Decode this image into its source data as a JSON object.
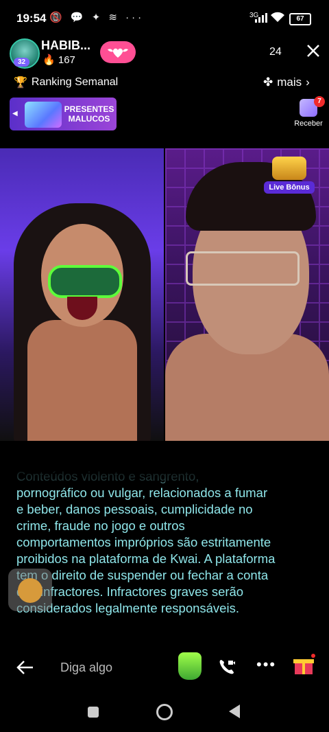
{
  "status_bar": {
    "time": "19:54",
    "left_icons": "📵 💬 ✦ ≋ ···",
    "network": "3G",
    "battery": "67"
  },
  "header": {
    "streamer_name": "HABIB...",
    "level": "32",
    "likes": "167",
    "viewers": "24",
    "ranking_label": "Ranking Semanal",
    "more_label": "mais"
  },
  "promo": {
    "line1": "PRESENTES",
    "line2": "MALUCOS"
  },
  "receber": {
    "badge": "7",
    "label": "Receber"
  },
  "live_bonus": {
    "label": "Live Bônus"
  },
  "notice": {
    "partial_top": "Conteúdos violento e sangrento,",
    "text": "pornográfico ou vulgar, relacionados a fumar e beber, danos pessoais, cumplicidade no crime, fraude no jogo e outros comportamentos impróprios são estritamente proibidos na plataforma de Kwai. A plataforma tem o direito de suspender ou fechar a conta dos infractores. Infractores graves serão considerados legalmente responsáveis."
  },
  "bottom_bar": {
    "input_placeholder": "Diga algo",
    "more_glyph": "•••"
  },
  "colors": {
    "follow_pink": "#ff4f94",
    "notice_text": "#8fe6ea",
    "promo_purple": "#7b3fd4",
    "badge_red": "#f02b2b"
  }
}
